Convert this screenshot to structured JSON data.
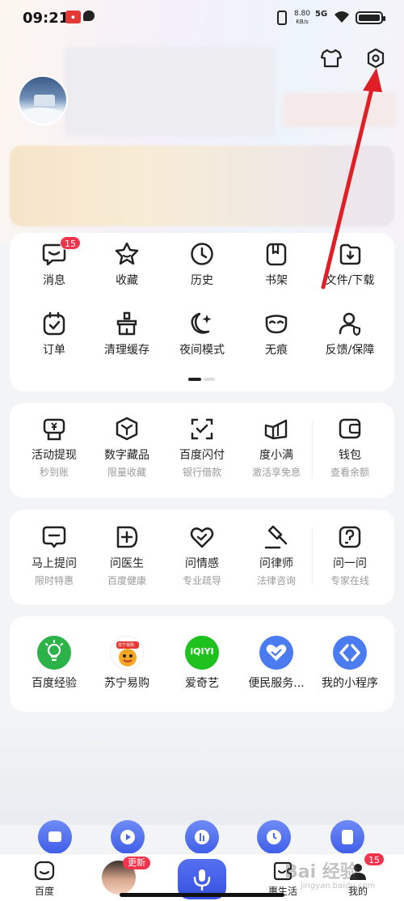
{
  "status_bar": {
    "time": "09:21",
    "net_speed_value": "8.80",
    "net_speed_unit": "KB/s",
    "network": "5G"
  },
  "quick_tools": {
    "row1": [
      {
        "label": "消息",
        "icon": "message-icon",
        "badge": "15"
      },
      {
        "label": "收藏",
        "icon": "star-icon"
      },
      {
        "label": "历史",
        "icon": "clock-icon"
      },
      {
        "label": "书架",
        "icon": "bookshelf-icon"
      },
      {
        "label": "文件/下载",
        "icon": "download-icon"
      }
    ],
    "row2": [
      {
        "label": "订单",
        "icon": "order-icon"
      },
      {
        "label": "清理缓存",
        "icon": "broom-icon"
      },
      {
        "label": "夜间模式",
        "icon": "moon-icon"
      },
      {
        "label": "无痕",
        "icon": "mask-icon"
      },
      {
        "label": "反馈/保障",
        "icon": "feedback-icon"
      }
    ]
  },
  "finance": [
    {
      "label": "活动提现",
      "sub": "秒到账",
      "icon": "wallet-yen-icon"
    },
    {
      "label": "数字藏品",
      "sub": "限量收藏",
      "icon": "cube-icon"
    },
    {
      "label": "百度闪付",
      "sub": "银行借款",
      "icon": "scan-pay-icon"
    },
    {
      "label": "度小满",
      "sub": "激活享免息",
      "icon": "duxiaoman-icon"
    },
    {
      "label": "钱包",
      "sub": "查看余额",
      "icon": "wallet-icon"
    }
  ],
  "services": [
    {
      "label": "马上提问",
      "sub": "限时特惠",
      "icon": "question-bubble-icon"
    },
    {
      "label": "问医生",
      "sub": "百度健康",
      "icon": "medical-icon"
    },
    {
      "label": "问情感",
      "sub": "专业疏导",
      "icon": "heart-icon"
    },
    {
      "label": "问律师",
      "sub": "法律咨询",
      "icon": "gavel-icon"
    },
    {
      "label": "问一问",
      "sub": "专家在线",
      "icon": "ask-icon"
    }
  ],
  "mini_apps": [
    {
      "label": "百度经验",
      "icon": "bulb-icon",
      "color": "#2bb34a"
    },
    {
      "label": "苏宁易购",
      "icon": "suning-icon",
      "color": "#f5a623",
      "logo_text": "苏宁易购"
    },
    {
      "label": "爱奇艺",
      "icon": "iqiyi-icon",
      "color": "#1ec11e",
      "logo_text": "iQIYI"
    },
    {
      "label": "便民服务...",
      "icon": "handshake-icon",
      "color": "#4a7bf0"
    },
    {
      "label": "我的小程序",
      "icon": "miniprogram-icon",
      "color": "#4a7bf0"
    }
  ],
  "tab_bar": {
    "home": "百度",
    "avatar_badge": "更新",
    "life": "惠生活",
    "mine": "我的",
    "mine_badge": "15"
  },
  "watermark": {
    "text": "Bai 经验",
    "sub": "jingyan.baidu.com"
  },
  "colors": {
    "accent": "#3f5ee8",
    "badge": "#f2344d",
    "arrow": "#e01e26"
  }
}
